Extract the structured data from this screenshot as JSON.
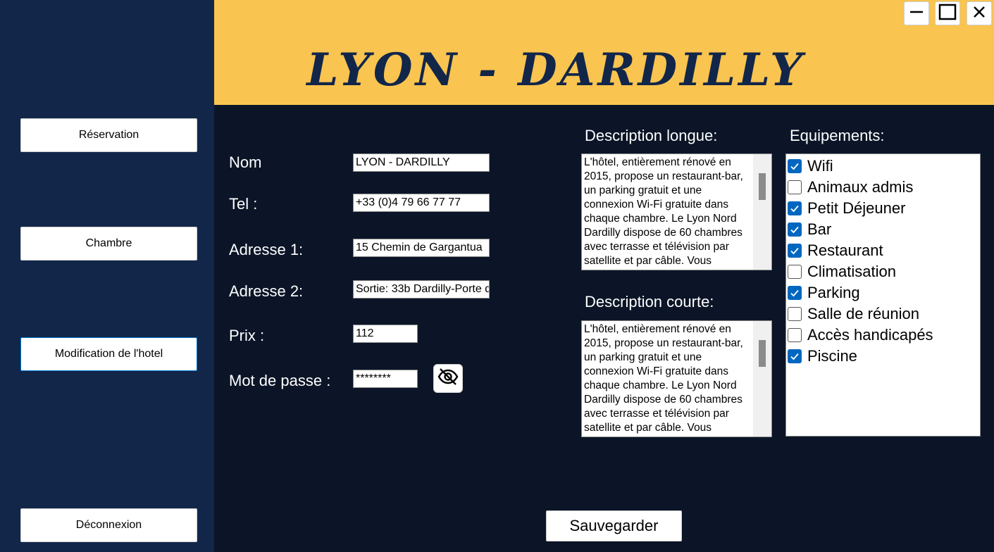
{
  "window": {
    "minimize_icon": "minimize-icon",
    "maximize_icon": "maximize-icon",
    "close_icon": "close-icon"
  },
  "header": {
    "title": "LYON - DARDILLY",
    "bg_color": "#f9c44f",
    "title_color": "#12264a"
  },
  "sidebar": {
    "bg_color": "#12264a",
    "items": [
      {
        "label": "Réservation",
        "active": false
      },
      {
        "label": "Chambre",
        "active": false
      },
      {
        "label": "Modification de l'hotel",
        "active": true
      },
      {
        "label": "Déconnexion",
        "active": false
      }
    ]
  },
  "form": {
    "nom": {
      "label": "Nom",
      "value": "LYON - DARDILLY"
    },
    "tel": {
      "label": "Tel :",
      "value": "+33 (0)4 79 66 77 77"
    },
    "adresse1": {
      "label": "Adresse 1:",
      "value": "15 Chemin de Gargantua"
    },
    "adresse2": {
      "label": "Adresse 2:",
      "value": "Sortie: 33b Dardilly-Porte d"
    },
    "prix": {
      "label": "Prix :",
      "value": "112"
    },
    "password": {
      "label": "Mot de passe :",
      "value": "********",
      "toggle_icon": "eye-off-icon"
    }
  },
  "descriptions": {
    "longue": {
      "label": "Description longue:",
      "text": "L'hôtel, entièrement rénové en\n2015, propose un restaurant-bar,\nun parking gratuit et une\nconnexion Wi-Fi gratuite dans\nchaque chambre. Le Lyon Nord\nDardilly dispose de 60 chambres\navec terrasse et télévision par\nsatellite et par câble. Vous"
    },
    "courte": {
      "label": "Description courte:",
      "text": "L'hôtel, entièrement rénové en\n2015, propose un restaurant-bar,\nun parking gratuit et une\nconnexion Wi-Fi gratuite dans\nchaque chambre. Le Lyon Nord\nDardilly dispose de 60 chambres\navec terrasse et télévision par\nsatellite et par câble. Vous"
    }
  },
  "equipements": {
    "label": "Equipements:",
    "items": [
      {
        "label": "Wifi",
        "checked": true
      },
      {
        "label": "Animaux admis",
        "checked": false
      },
      {
        "label": "Petit Déjeuner",
        "checked": true
      },
      {
        "label": "Bar",
        "checked": true
      },
      {
        "label": "Restaurant",
        "checked": true
      },
      {
        "label": "Climatisation",
        "checked": false
      },
      {
        "label": "Parking",
        "checked": true
      },
      {
        "label": "Salle de réunion",
        "checked": false
      },
      {
        "label": "Accès handicapés",
        "checked": false
      },
      {
        "label": "Piscine",
        "checked": true
      }
    ],
    "check_color": "#0067c0"
  },
  "actions": {
    "save_label": "Sauvegarder"
  }
}
